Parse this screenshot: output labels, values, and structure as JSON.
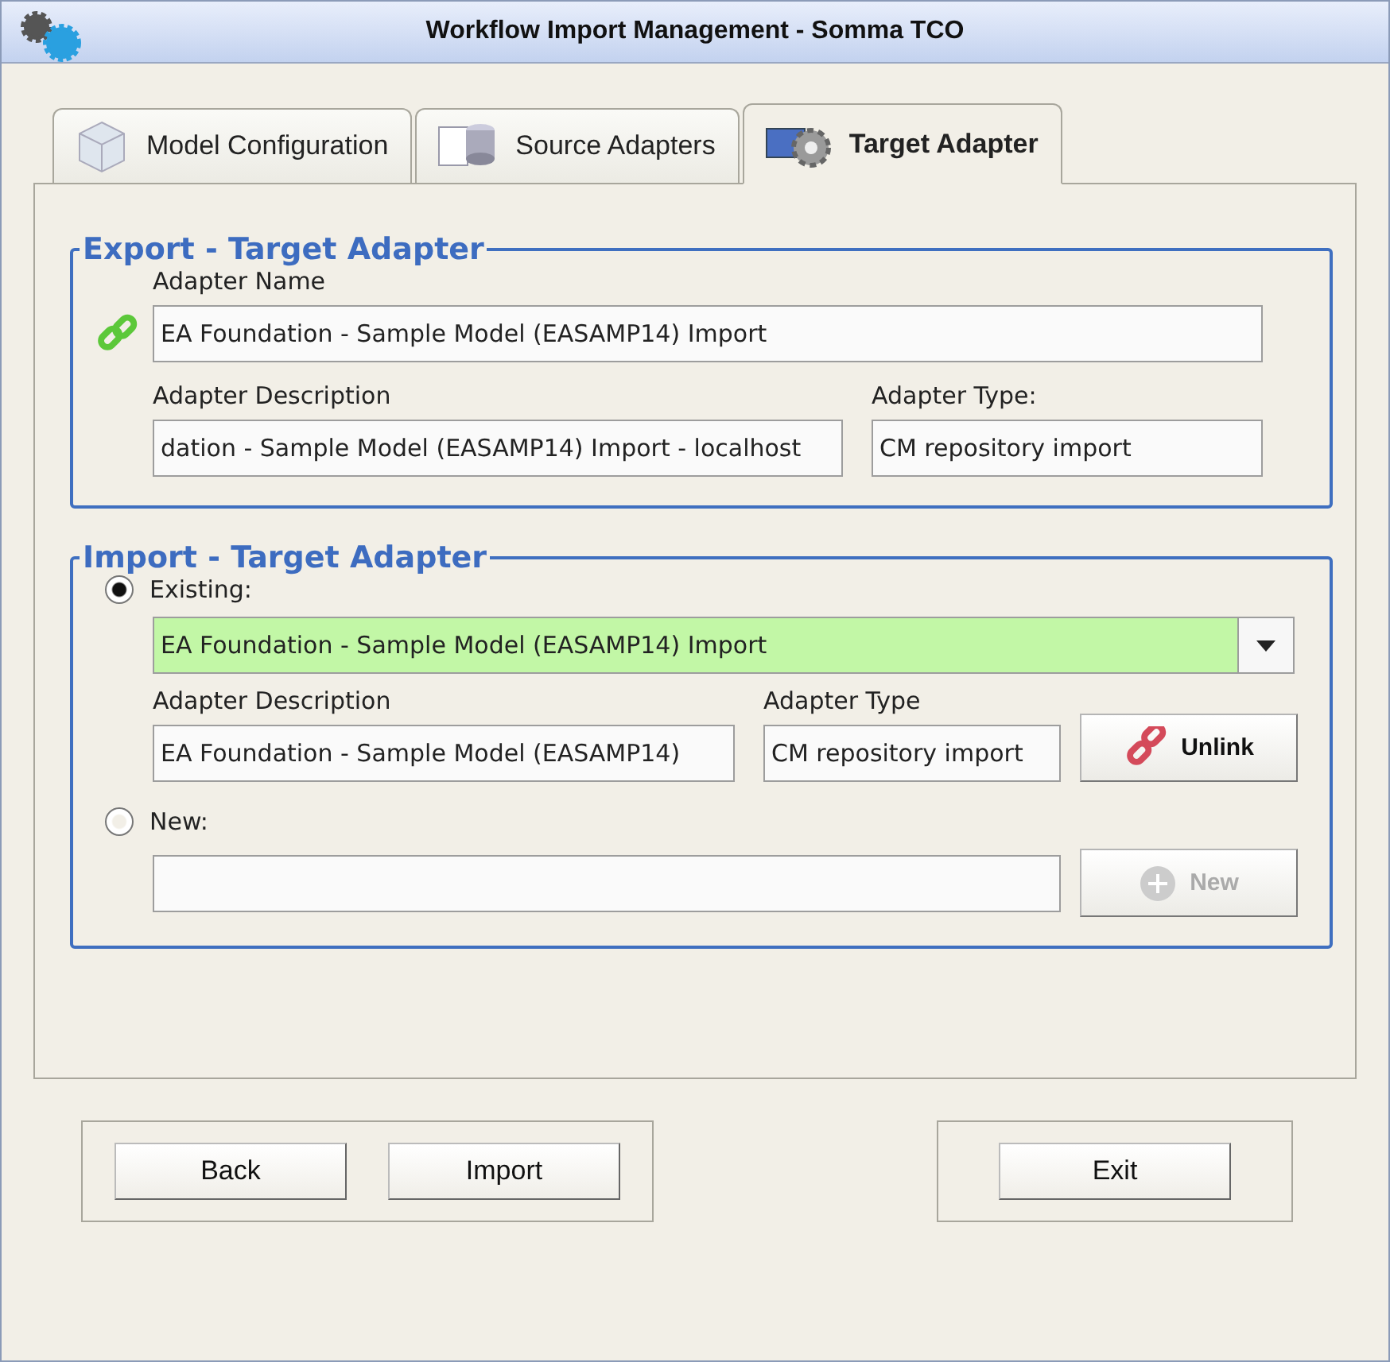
{
  "window": {
    "title": "Workflow Import Management - Somma TCO"
  },
  "tabs": [
    {
      "label": "Model Configuration",
      "selected": false
    },
    {
      "label": "Source Adapters",
      "selected": false
    },
    {
      "label": "Target Adapter",
      "selected": true
    }
  ],
  "export_group": {
    "title": "Export - Target Adapter",
    "name_label": "Adapter Name",
    "name_value": "EA Foundation - Sample Model (EASAMP14) Import",
    "description_label": "Adapter Description",
    "description_value": "dation - Sample Model (EASAMP14) Import - localhost",
    "type_label": "Adapter Type:",
    "type_value": "CM repository import"
  },
  "import_group": {
    "title": "Import - Target Adapter",
    "options": [
      {
        "label": "Existing:",
        "selected": true
      },
      {
        "label": "New:",
        "selected": false
      }
    ],
    "existing_value": "EA Foundation - Sample Model (EASAMP14) Import",
    "description_label": "Adapter Description",
    "description_value": "EA Foundation - Sample Model (EASAMP14)",
    "type_label": "Adapter Type",
    "type_value": "CM repository import",
    "unlink_button": {
      "label": "Unlink",
      "disabled": false
    },
    "new_button": {
      "label": "New",
      "disabled": true
    }
  },
  "buttons_left": [
    "Back",
    "Import"
  ],
  "buttons_right": [
    "Exit"
  ]
}
